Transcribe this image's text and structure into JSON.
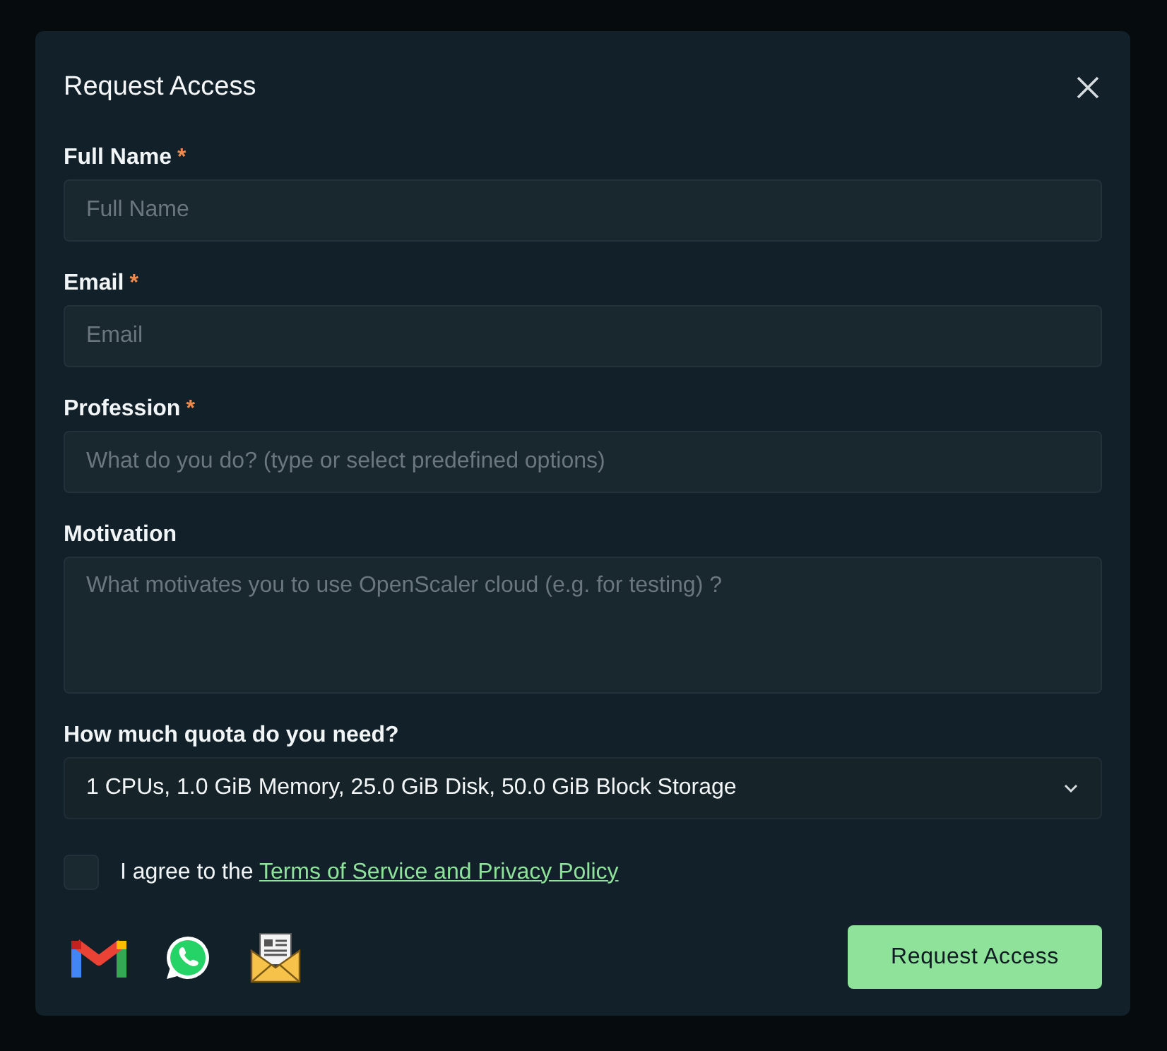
{
  "dialog": {
    "title": "Request Access"
  },
  "fields": [
    {
      "kind": "input",
      "label": "Full Name",
      "required_mark": "*",
      "placeholder": "Full Name"
    },
    {
      "kind": "input",
      "label": "Email",
      "required_mark": "*",
      "placeholder": "Email"
    },
    {
      "kind": "input",
      "label": "Profession",
      "required_mark": "*",
      "placeholder": "What do you do? (type or select predefined options)"
    },
    {
      "kind": "textarea",
      "label": "Motivation",
      "placeholder": "What motivates you to use OpenScaler cloud (e.g. for testing) ?"
    }
  ],
  "quota": {
    "label": "How much quota do you need?",
    "value": "1 CPUs, 1.0 GiB Memory, 25.0 GiB Disk, 50.0 GiB Block Storage"
  },
  "agreement": {
    "checked": false,
    "text": "I agree to the",
    "link": "Terms of Service and Privacy Policy"
  },
  "contacts": [
    {
      "kind": "gmail"
    },
    {
      "kind": "whatsapp"
    },
    {
      "kind": "newsletter"
    }
  ],
  "submit": {
    "label": "Request Access"
  }
}
